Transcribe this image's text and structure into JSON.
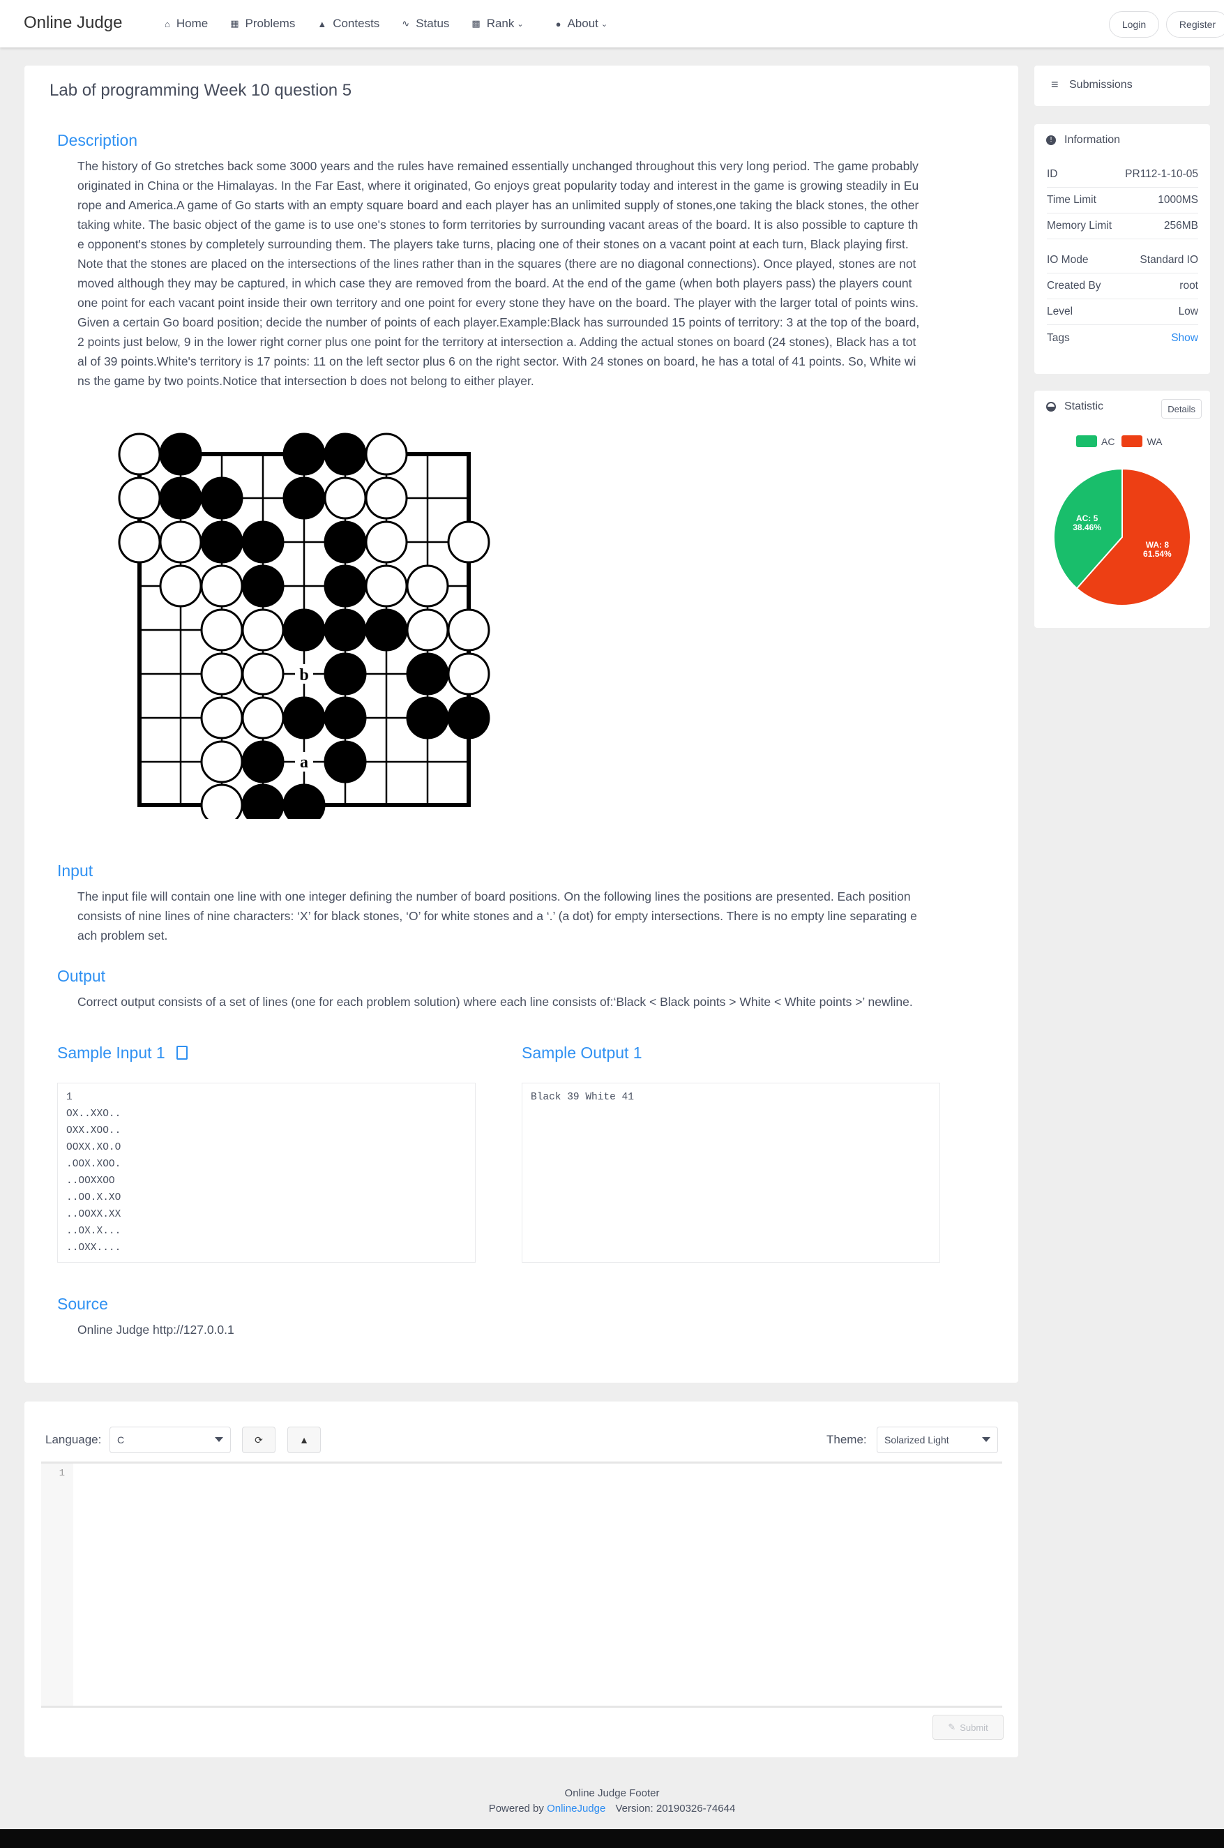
{
  "header": {
    "brand": "Online Judge",
    "nav": [
      {
        "label": "Home",
        "icon": "home-icon"
      },
      {
        "label": "Problems",
        "icon": "grid-icon"
      },
      {
        "label": "Contests",
        "icon": "trophy-icon"
      },
      {
        "label": "Status",
        "icon": "pulse-icon"
      },
      {
        "label": "Rank",
        "icon": "bar-chart-icon"
      },
      {
        "label": "About",
        "icon": "info-icon"
      }
    ],
    "login_label": "Login",
    "register_label": "Register"
  },
  "problem": {
    "title": "Lab of programming Week 10 question 5",
    "description_title": "Description",
    "description_lines": [
      "The history of Go stretches back some 3000 years and the rules have remained essentially unchanged throughout this very long period. The game probably",
      "originated in China or the Himalayas. In the Far East, where it originated, Go enjoys great popularity today and interest in the game is growing steadily in Eu",
      "rope and America.A game of Go starts with an empty square board and each player has an unlimited supply of stones,one taking the black stones, the other",
      "taking white. The basic object of the game is to use one's stones to form territories by surrounding vacant areas of the board. It is also possible to capture th",
      "e opponent's stones by completely surrounding them. The players take turns, placing one of their stones on a vacant point at each turn, Black playing first.",
      "Note that the stones are placed on the intersections of the lines rather than in the squares (there are no diagonal connections). Once played, stones are not",
      "moved although they may be captured, in which case they are removed from the board. At the end of the game (when both players pass) the players count",
      "one point for each vacant point inside their own territory and one point for every stone they have on the board. The player with the larger total of points wins.",
      "Given a certain Go board position; decide the number of points of each player.Example:Black has surrounded 15 points of territory: 3 at the top of the board,",
      "2 points just below, 9 in the lower right corner plus one point for the territory at intersection a. Adding the actual stones on board (24 stones), Black has a tot",
      "al of 39 points.White's territory is 17 points: 11 on the left sector plus 6 on the right sector. With 24 stones on board, he has a total of 41 points. So, White wi",
      "ns the game by two points.Notice that intersection b does not belong to either player."
    ],
    "board_labels": {
      "a": "a",
      "b": "b"
    },
    "input_title": "Input",
    "input_lines": [
      "The input file will contain one line with one integer defining the number of board positions. On the following lines the positions are presented. Each position",
      "consists of nine lines of nine characters: ‘X’ for black stones, ‘O’ for white stones and a ‘.’ (a dot) for empty intersections. There is no empty line separating e",
      "ach problem set."
    ],
    "output_title": "Output",
    "output_text": "Correct output consists of a set of lines (one for each problem solution) where each line consists of:‘Black < Black points > White < White points >’ newline.",
    "sample_input_title": "Sample Input 1",
    "sample_input": "1\nOX..XXO..\nOXX.XOO..\nOOXX.XO.O\n.OOX.XOO.\n..OOXXOO\n..OO.X.XO\n..OOXX.XX\n..OX.X...\n..OXX....",
    "sample_output_title": "Sample Output 1",
    "sample_output": "Black 39 White 41",
    "source_title": "Source",
    "source_text": "Online Judge http://127.0.0.1"
  },
  "sidebar": {
    "submissions_label": "Submissions",
    "info_title": "Information",
    "info_rows": [
      {
        "k": "ID",
        "v": "PR112-1-10-05"
      },
      {
        "k": "Time Limit",
        "v": "1000MS"
      },
      {
        "k": "Memory Limit",
        "v": "256MB"
      },
      {
        "k": "IO Mode",
        "v": "Standard IO"
      },
      {
        "k": "Created By",
        "v": "root"
      },
      {
        "k": "Level",
        "v": "Low"
      },
      {
        "k": "Tags",
        "v": "Show"
      }
    ],
    "stat_title": "Statistic",
    "details_label": "Details"
  },
  "chart_data": {
    "type": "pie",
    "categories": [
      "AC",
      "WA"
    ],
    "values": [
      5,
      8
    ],
    "slice_labels": [
      [
        "AC: 5",
        "38.46%"
      ],
      [
        "WA: 8",
        "61.54%"
      ]
    ],
    "colors": [
      "#19be6b",
      "#ed3f14"
    ],
    "legend": "top"
  },
  "editor": {
    "language_label": "Language:",
    "language_value": "C",
    "theme_label": "Theme:",
    "theme_value": "Solarized Light",
    "line_number": "1",
    "submit_label": "Submit"
  },
  "footer": {
    "line1": "Online Judge Footer",
    "powered_prefix": "Powered by",
    "powered_link": "OnlineJudge",
    "version": "Version: 20190326-74644"
  }
}
